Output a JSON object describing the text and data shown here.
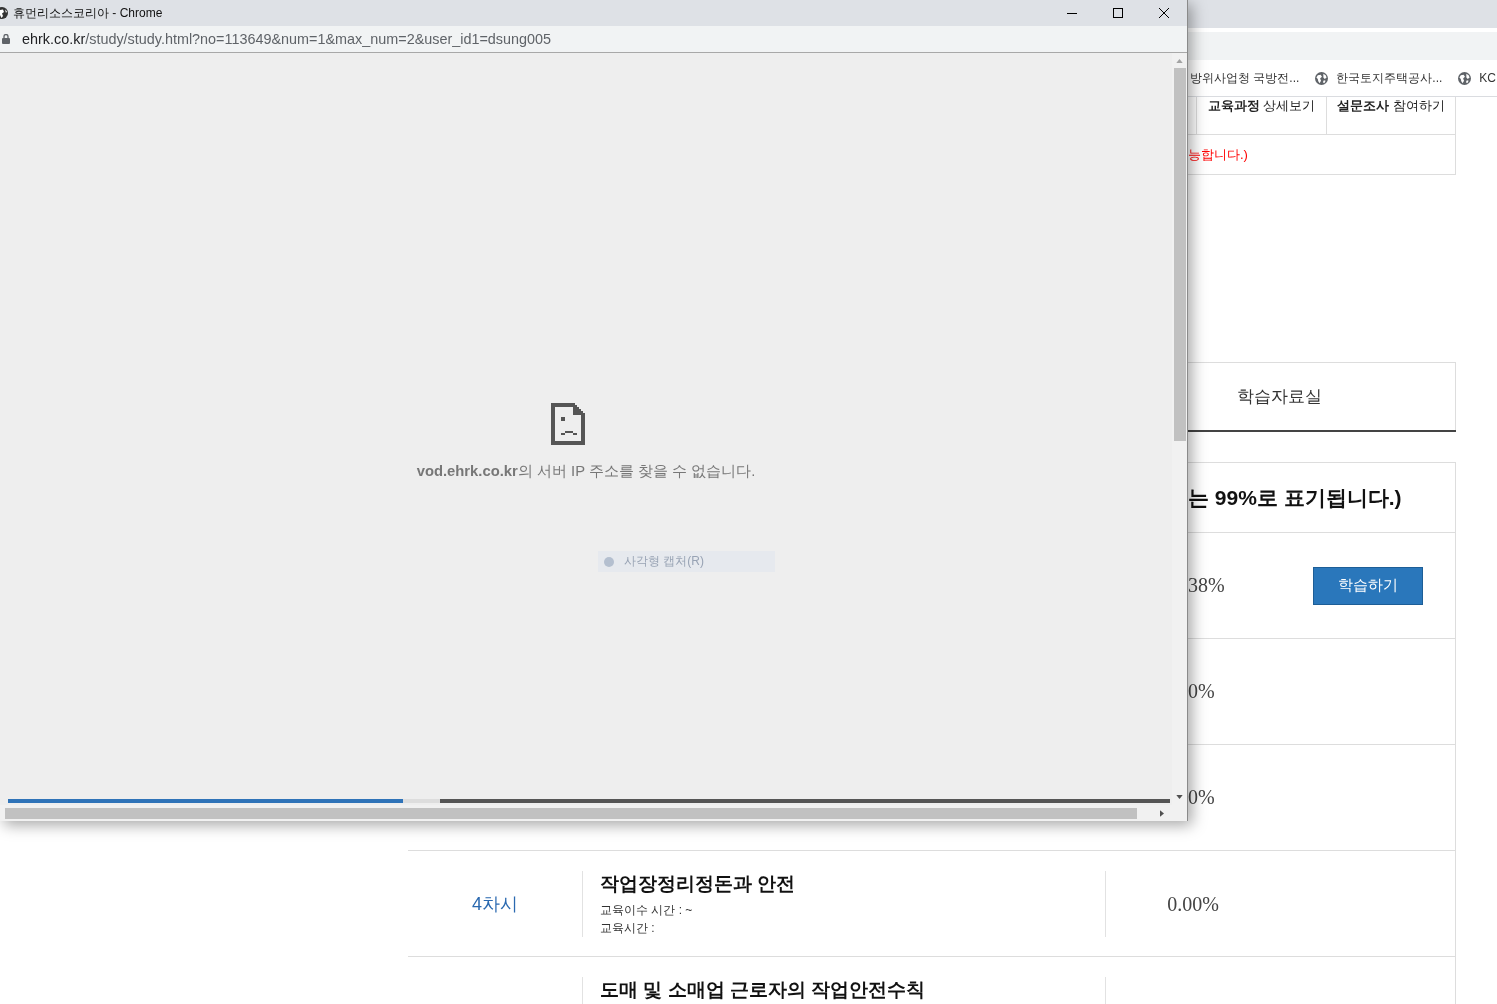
{
  "popup": {
    "title": "휴먼리소스코리아 - Chrome",
    "url": {
      "host": "ehrk.co.kr",
      "path": "/study/study.html?no=113649&num=1&max_num=2&user_id1=dsung005"
    },
    "error": {
      "message": "**vod.ehrk.co.kr**의 서버 IP 주소를 찾을 수 없습니다."
    },
    "capture_hint": "사각형 캡처(R)",
    "loading": {
      "level": 0.34
    }
  },
  "background_page": {
    "bookmarks": [
      {
        "kind": "text",
        "label": "방위사업청 국방전..."
      },
      {
        "kind": "globe",
        "label": "한국토지주택공사..."
      },
      {
        "kind": "globe",
        "label": "KC"
      }
    ],
    "course_links": [
      {
        "label": "**교육과정** 상세보기"
      },
      {
        "label": "**설문조사** 참여하기"
      }
    ],
    "notice": "능합니다.)",
    "tabs": [
      {
        "label": "학습자료실"
      }
    ],
    "progress_table": {
      "note": "는 99%로 표기됩니다.)",
      "rows": [
        {
          "kind": "partial",
          "progress": "38%",
          "button": "학습하기"
        },
        {
          "kind": "partial",
          "progress": "0%"
        },
        {
          "kind": "partial",
          "progress": "0%"
        },
        {
          "kind": "full",
          "session": "4차시",
          "title": "작업장정리정돈과 안전",
          "details": [
            "교육이수 시간 : ~",
            "교육시간 :"
          ],
          "progress": "0.00%"
        },
        {
          "kind": "full",
          "title": "도매 및 소매업 근로자의 작업안전수칙"
        }
      ]
    }
  }
}
